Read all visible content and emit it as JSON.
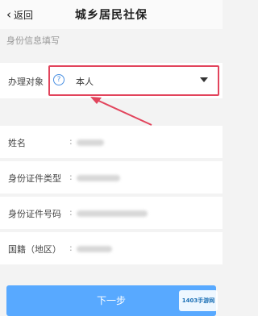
{
  "header": {
    "back_label": "返回",
    "title": "城乡居民社保"
  },
  "section_title": "身份信息填写",
  "applicant": {
    "label": "办理对象",
    "value": "本人",
    "help_icon": "question-circle-icon",
    "highlight_color": "#e2445c"
  },
  "fields": [
    {
      "label": "姓名",
      "colon": ":"
    },
    {
      "label": "身份证件类型",
      "colon": ":"
    },
    {
      "label": "身份证件号码",
      "colon": ":"
    },
    {
      "label": "国籍（地区）",
      "colon": ":"
    }
  ],
  "next_button": {
    "label": "下一步",
    "color": "#58a9ff"
  },
  "watermark": {
    "text": "1403手游网"
  }
}
